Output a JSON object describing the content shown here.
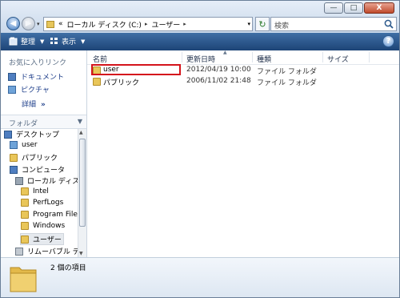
{
  "window": {
    "minimize": "—",
    "maximize": "□",
    "close": "X"
  },
  "nav": {
    "back": "◀",
    "forward": "▶",
    "recent": "▾"
  },
  "address": {
    "chevron": "«",
    "crumbs": [
      "ローカル ディスク (C:)",
      "ユーザー"
    ],
    "separator": "▸"
  },
  "search": {
    "placeholder": "検索"
  },
  "toolbar": {
    "organize": "整理",
    "views": "表示",
    "arrow": "▼",
    "help": "?"
  },
  "left": {
    "favorites_title": "お気に入りリンク",
    "favorites": [
      "ドキュメント",
      "ピクチャ"
    ],
    "more": "詳細",
    "more_arrow": "»",
    "folders_title": "フォルダ",
    "folders_arrow": "▼",
    "tree": [
      "デスクトップ",
      "user",
      "パブリック",
      "コンピュータ",
      "ローカル ディスク",
      "Intel",
      "PerfLogs",
      "Program Files",
      "Windows",
      "ユーザー",
      "リムーバブル ディ"
    ]
  },
  "columns": {
    "name": "名前",
    "date": "更新日時",
    "type": "種類",
    "size": "サイズ"
  },
  "rows": [
    {
      "name": "user",
      "date": "2012/04/19 10:00",
      "type": "ファイル フォルダ"
    },
    {
      "name": "パブリック",
      "date": "2006/11/02 21:48",
      "type": "ファイル フォルダ"
    }
  ],
  "details": {
    "count": "2 個の項目"
  },
  "colors": {
    "highlight": "#d4141c",
    "link": "#1e3e8a",
    "toolbar": "#2b5a92"
  }
}
